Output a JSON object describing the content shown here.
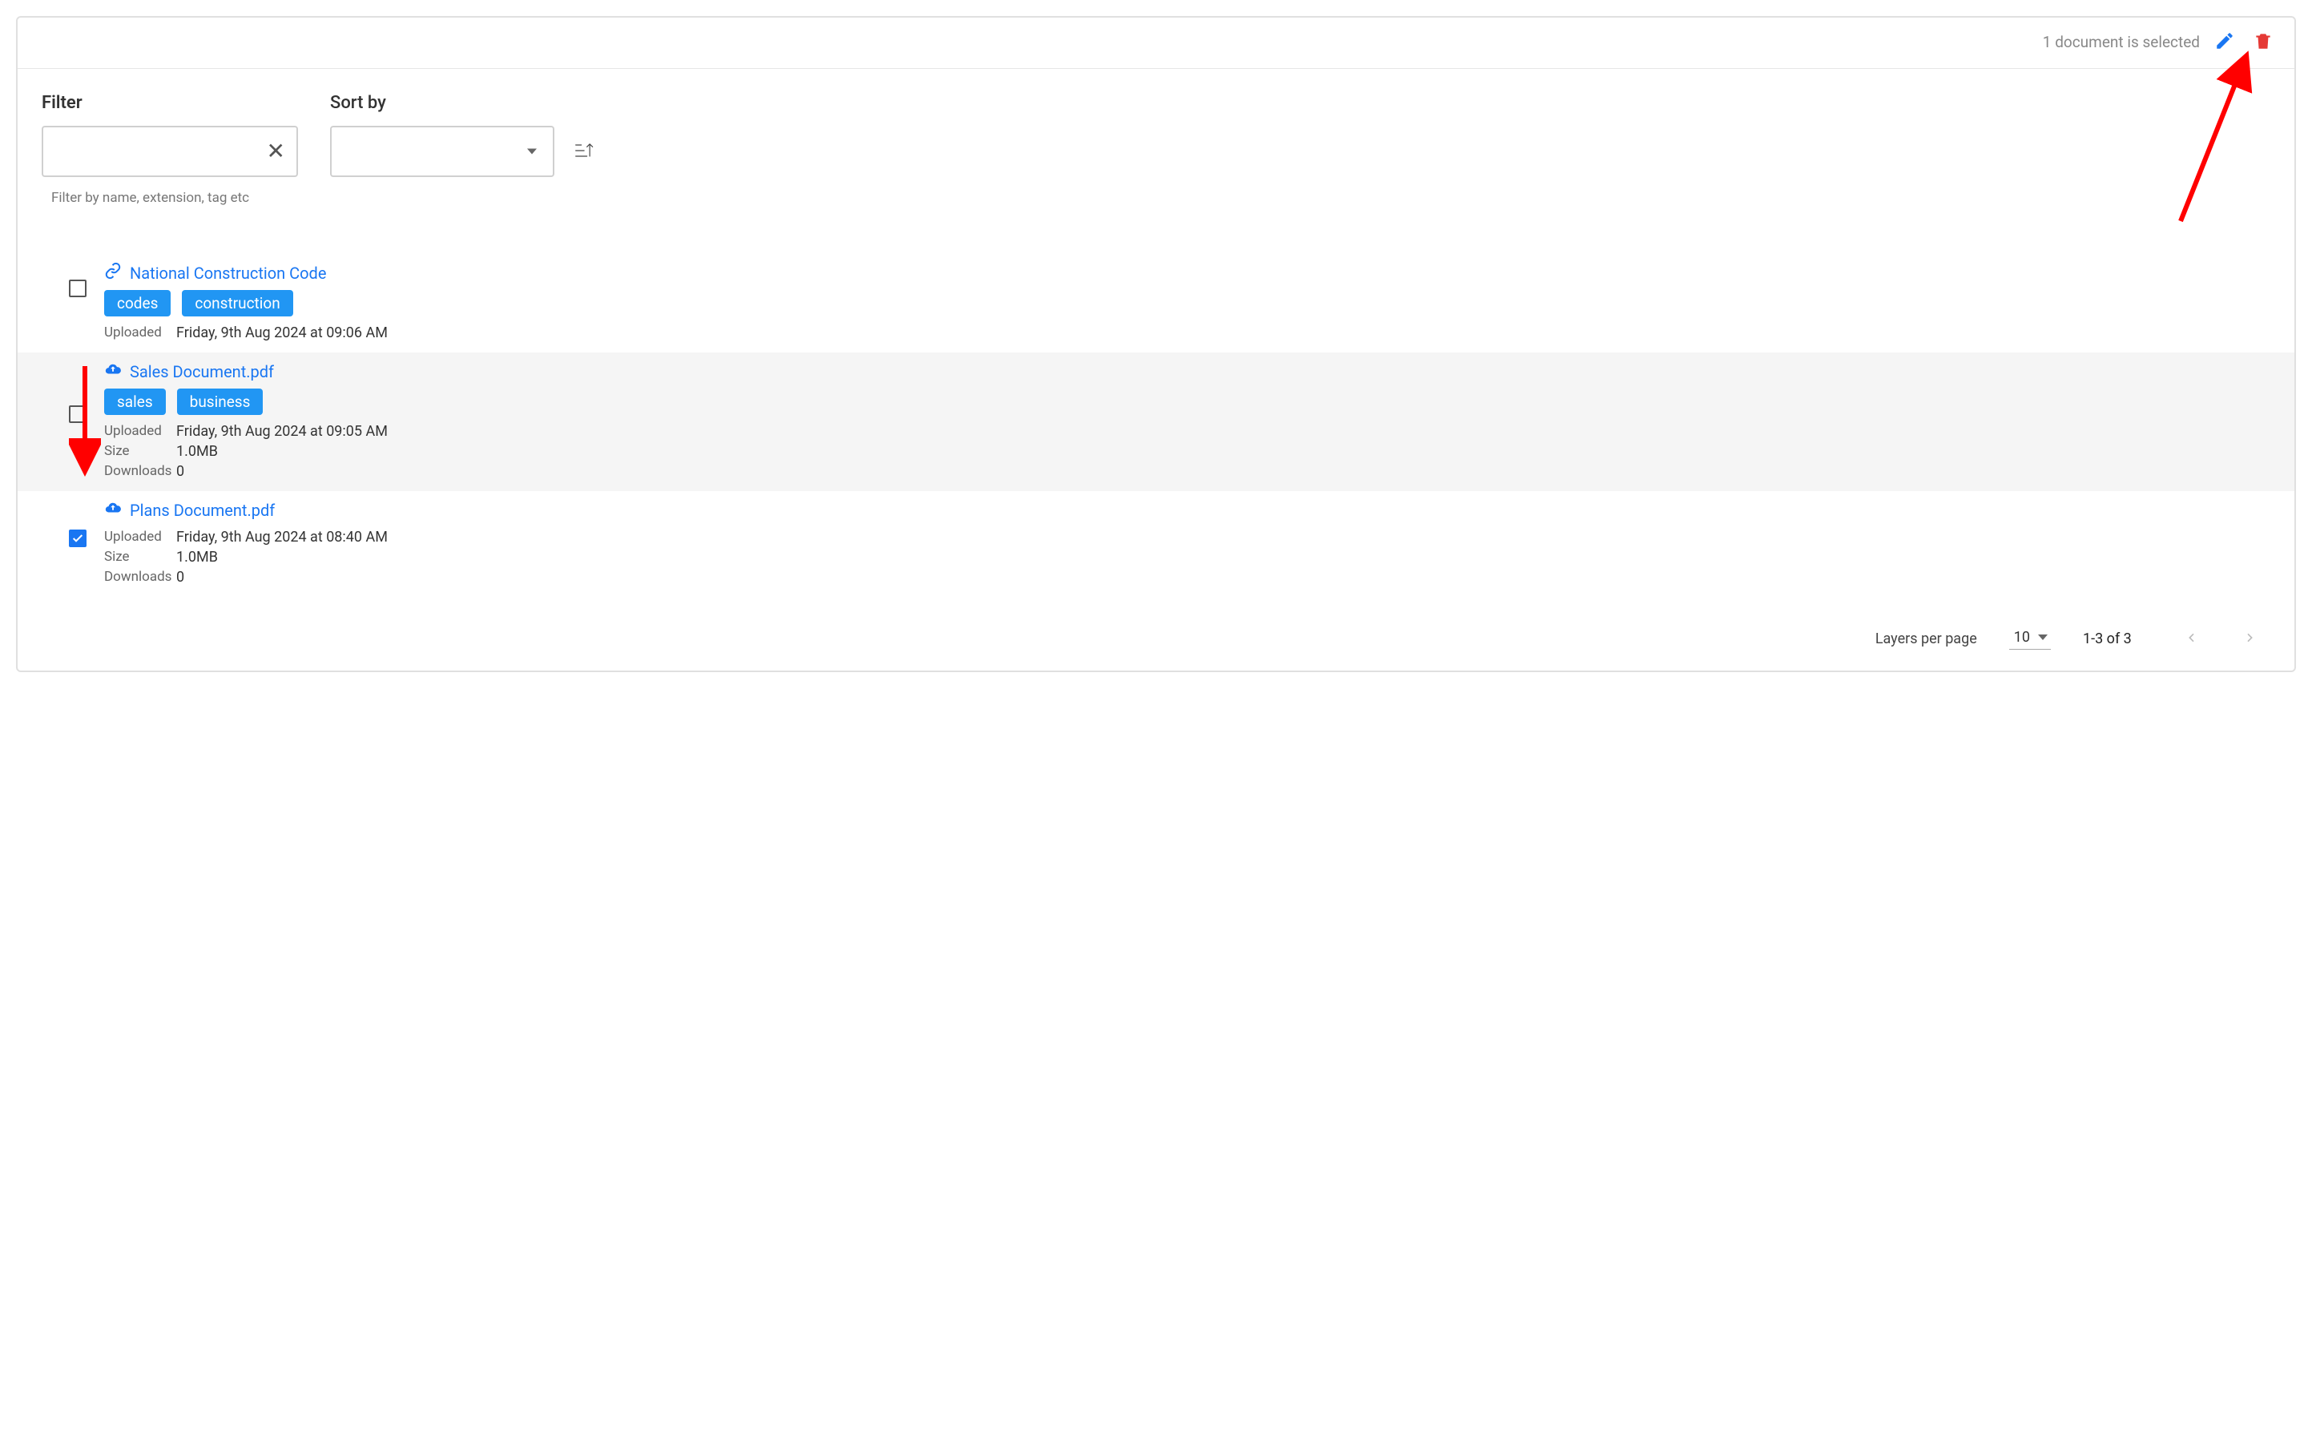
{
  "selection_bar": {
    "text": "1 document is selected"
  },
  "controls": {
    "filter_label": "Filter",
    "filter_value": "",
    "filter_helper": "Filter by name, extension, tag etc",
    "sort_label": "Sort by",
    "sort_value": ""
  },
  "documents": [
    {
      "icon": "link",
      "title": "National Construction Code",
      "tags": [
        "codes",
        "construction"
      ],
      "checked": false,
      "highlight": false,
      "meta": {
        "uploaded_label": "Uploaded",
        "uploaded": "Friday, 9th Aug 2024 at 09:06 AM"
      }
    },
    {
      "icon": "cloud-upload",
      "title": "Sales Document.pdf",
      "tags": [
        "sales",
        "business"
      ],
      "checked": false,
      "highlight": true,
      "meta": {
        "uploaded_label": "Uploaded",
        "uploaded": "Friday, 9th Aug 2024 at 09:05 AM",
        "size_label": "Size",
        "size": "1.0MB",
        "downloads_label": "Downloads",
        "downloads": "0"
      }
    },
    {
      "icon": "cloud-upload",
      "title": "Plans Document.pdf",
      "tags": [],
      "checked": true,
      "highlight": false,
      "meta": {
        "uploaded_label": "Uploaded",
        "uploaded": "Friday, 9th Aug 2024 at 08:40 AM",
        "size_label": "Size",
        "size": "1.0MB",
        "downloads_label": "Downloads",
        "downloads": "0"
      }
    }
  ],
  "pager": {
    "label": "Layers per page",
    "per_page": "10",
    "range": "1-3 of 3"
  }
}
